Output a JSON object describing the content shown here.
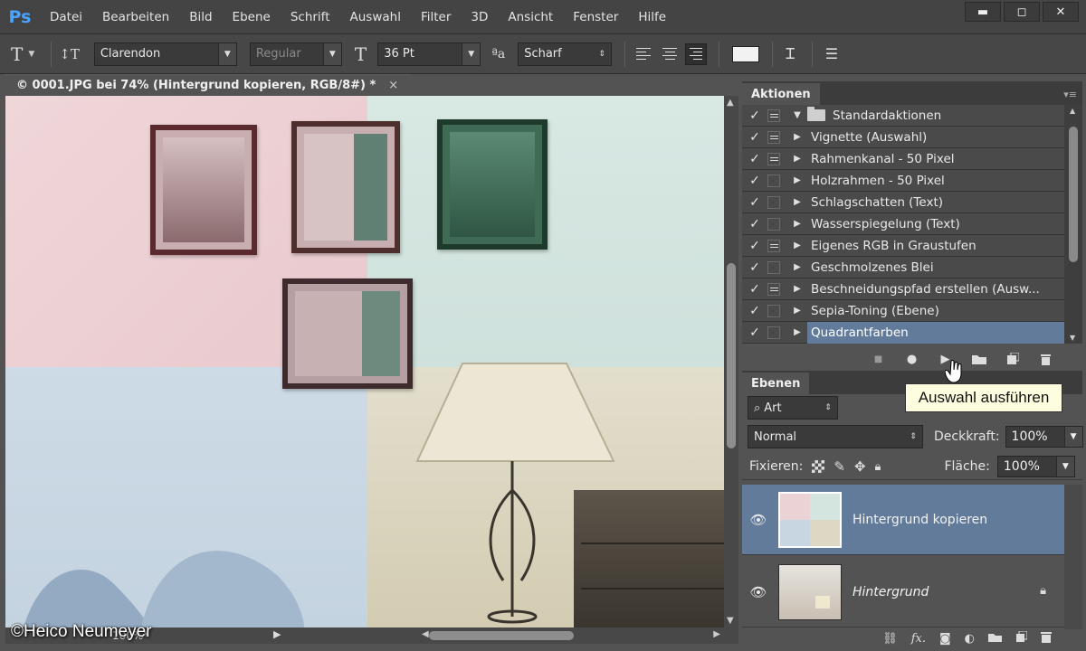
{
  "app": {
    "logo": "Ps"
  },
  "menu": [
    "Datei",
    "Bearbeiten",
    "Bild",
    "Ebene",
    "Schrift",
    "Auswahl",
    "Filter",
    "3D",
    "Ansicht",
    "Fenster",
    "Hilfe"
  ],
  "window_controls": {
    "minimize": "▬",
    "maximize": "◻",
    "close": "✕"
  },
  "options": {
    "tool_icon": "T",
    "orient_icon": "↕T",
    "font_family": "Clarendon",
    "font_style": "Regular",
    "size_icon": "T",
    "font_size": "36 Pt",
    "aa_icon": "ªa",
    "antialias": "Scharf",
    "warp_icon": "Ꮖ",
    "panel_icon": "☰"
  },
  "document": {
    "tab_title": "© 0001.JPG bei 74% (Hintergrund kopieren, RGB/8#) *",
    "close": "×",
    "zoom_status": "100%*",
    "watermark": "©Heico Neumeyer"
  },
  "actions_panel": {
    "tab": "Aktionen",
    "menu_icon": "▾≡",
    "set_name": "Standardaktionen",
    "items": [
      {
        "name": "Vignette (Auswahl)",
        "dialog": true
      },
      {
        "name": "Rahmenkanal - 50 Pixel",
        "dialog": true
      },
      {
        "name": "Holzrahmen - 50 Pixel",
        "dialog": false
      },
      {
        "name": "Schlagschatten (Text)",
        "dialog": false
      },
      {
        "name": "Wasserspiegelung (Text)",
        "dialog": false
      },
      {
        "name": "Eigenes RGB in Graustufen",
        "dialog": true
      },
      {
        "name": "Geschmolzenes Blei",
        "dialog": false
      },
      {
        "name": "Beschneidungspfad erstellen (Ausw...",
        "dialog": true
      },
      {
        "name": "Sepia-Toning (Ebene)",
        "dialog": false
      },
      {
        "name": "Quadrantfarben",
        "dialog": false,
        "selected": true
      }
    ],
    "check_glyph": "✓",
    "tooltip": "Auswahl ausführen"
  },
  "layers_panel": {
    "tab": "Ebenen",
    "filter": "Art",
    "filter_icon": "⌕",
    "blend_mode": "Normal",
    "opacity_label": "Deckkraft:",
    "opacity_value": "100%",
    "lock_label": "Fixieren:",
    "fill_label": "Fläche:",
    "fill_value": "100%",
    "layers": [
      {
        "name": "Hintergrund kopieren",
        "selected": true
      },
      {
        "name": "Hintergrund",
        "selected": false,
        "locked": true
      }
    ],
    "footer_icons": [
      "link-icon",
      "fx-icon",
      "mask-icon",
      "adjustment-icon",
      "group-folder-icon",
      "new-layer-icon",
      "trash-icon"
    ],
    "fx_text": "fx."
  },
  "colors": {
    "accent_selection": "#627b9b",
    "tooltip_bg": "#fffde0",
    "logo_blue": "#4aa3ff"
  }
}
